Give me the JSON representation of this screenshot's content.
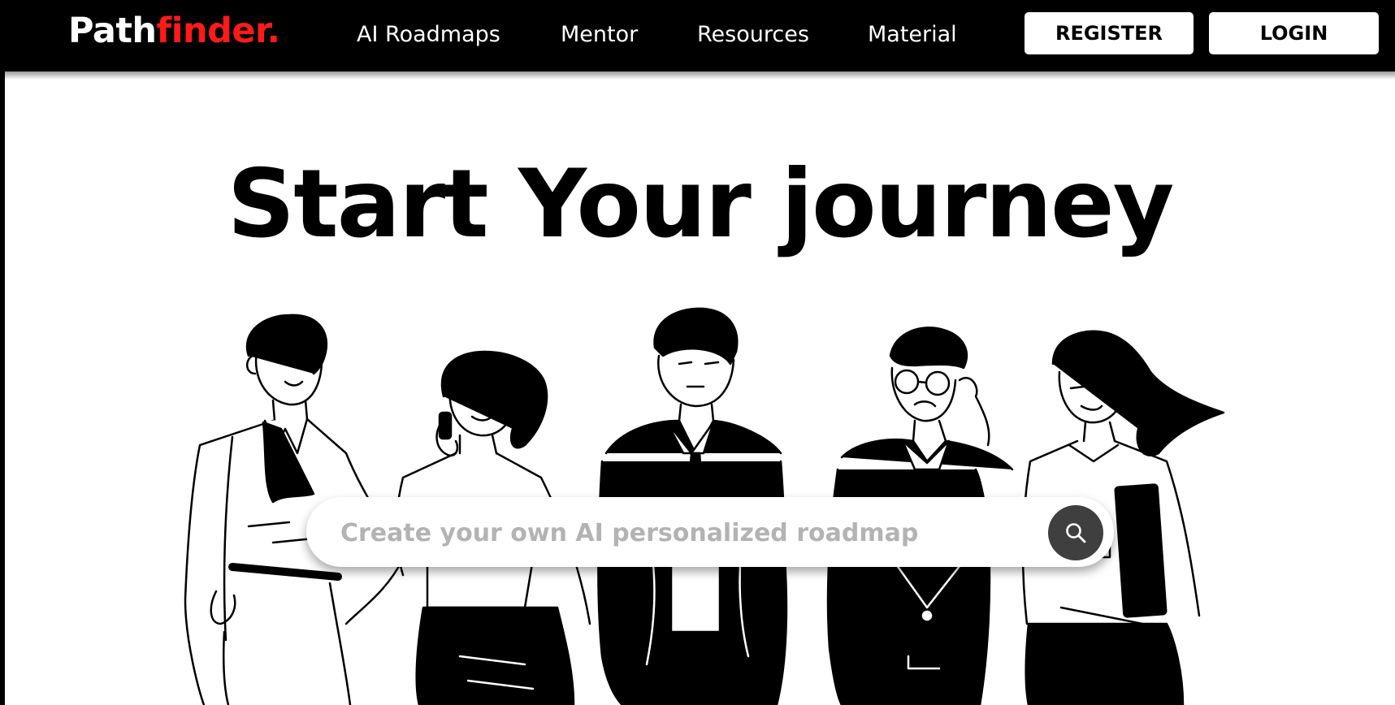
{
  "brand": {
    "part1": "Path",
    "part2": "finder."
  },
  "nav": {
    "items": [
      {
        "label": "AI Roadmaps"
      },
      {
        "label": "Mentor"
      },
      {
        "label": "Resources"
      },
      {
        "label": "Material"
      }
    ],
    "register_label": "REGISTER",
    "login_label": "LOGIN"
  },
  "hero": {
    "title": "Start Your journey"
  },
  "search": {
    "placeholder": "Create your own AI personalized roadmap",
    "value": ""
  },
  "colors": {
    "background": "#000000",
    "brand_accent": "#ff1a1a",
    "panel": "#ffffff",
    "search_button": "#3f3f3f"
  },
  "icons": {
    "search": "search-icon"
  }
}
